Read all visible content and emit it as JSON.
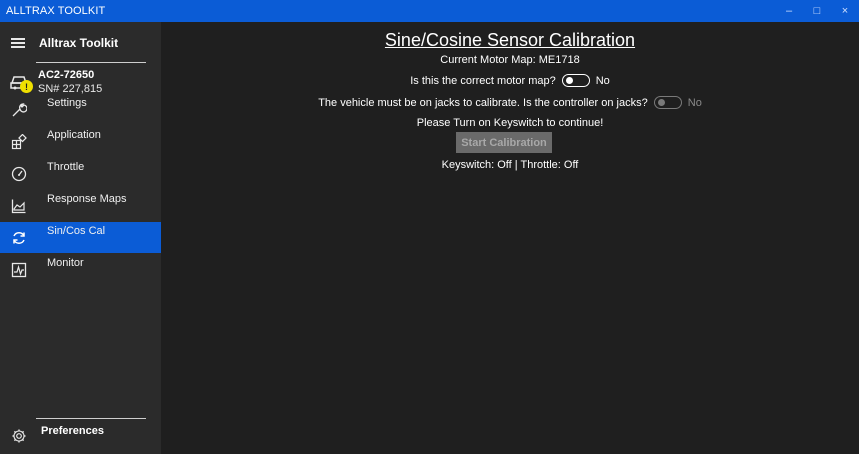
{
  "window": {
    "title": "ALLTRAX TOOLKIT",
    "controls": {
      "minimize": "–",
      "maximize": "□",
      "close": "×"
    }
  },
  "sidebar": {
    "title": "Alltrax Toolkit",
    "device": {
      "name": "AC2-72650",
      "serial": "SN# 227,815",
      "warning_glyph": "!"
    },
    "items": [
      {
        "label": "Settings",
        "icon": "wrench-icon"
      },
      {
        "label": "Application",
        "icon": "application-icon"
      },
      {
        "label": "Throttle",
        "icon": "gauge-icon"
      },
      {
        "label": "Response Maps",
        "icon": "chart-icon"
      },
      {
        "label": "Sin/Cos Cal",
        "icon": "refresh-icon",
        "active": true
      },
      {
        "label": "Monitor",
        "icon": "monitor-icon"
      }
    ],
    "footer": {
      "label": "Preferences",
      "icon": "gear-icon"
    }
  },
  "main": {
    "title": "Sine/Cosine Sensor Calibration",
    "motor_map": "Current Motor Map: ME1718",
    "question_map": "Is this the correct motor map?",
    "question_map_value": "No",
    "question_jacks": "The vehicle must be on jacks to calibrate. Is the controller on jacks?",
    "question_jacks_value": "No",
    "keyswitch_prompt": "Please Turn on Keyswitch to continue!",
    "start_button": "Start Calibration",
    "status": "Keyswitch: Off  |  Throttle: Off"
  },
  "colors": {
    "accent": "#0b5cd6",
    "warning": "#f0e000"
  }
}
